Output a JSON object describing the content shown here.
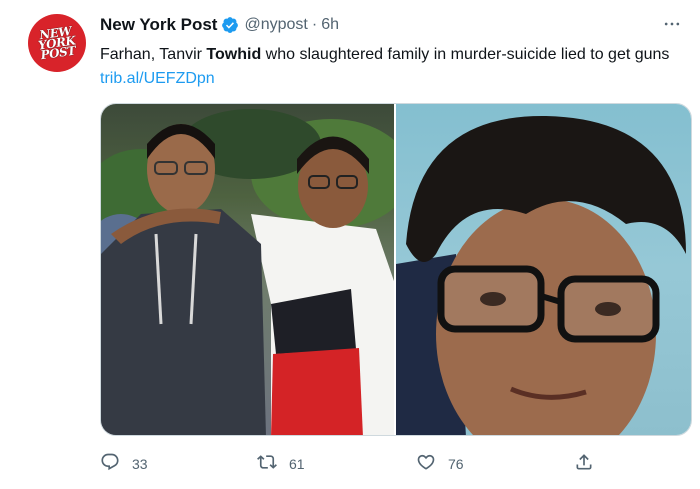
{
  "account": {
    "display_name": "New York Post",
    "handle": "@nypost",
    "separator": "·",
    "time": "6h",
    "avatar_logo_text": [
      "NEW",
      "YORK",
      "POST"
    ]
  },
  "tweet": {
    "text_before_bold": "Farhan, Tanvir ",
    "text_bold": "Towhid",
    "text_after_bold": " who slaughtered family in murder-suicide lied to get guns ",
    "link_text": "trib.al/UEFZDpn"
  },
  "media": {
    "photo_count": 2
  },
  "actions": {
    "reply_count": "33",
    "retweet_count": "61",
    "like_count": "76"
  },
  "colors": {
    "brand_red": "#d8232a",
    "verified_blue": "#1d9bf0",
    "link_blue": "#1d9bf0",
    "secondary_text": "#536471"
  },
  "icons": {
    "verified": "verified-badge-icon",
    "more": "more-options-icon",
    "reply": "reply-icon",
    "retweet": "retweet-icon",
    "like": "heart-icon",
    "share": "share-icon"
  }
}
